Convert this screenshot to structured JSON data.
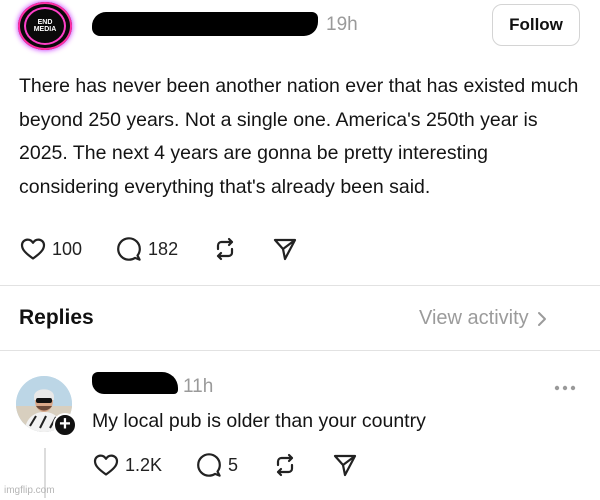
{
  "post": {
    "avatar": {
      "line1": "END",
      "line2": "MEDIA"
    },
    "time": "19h",
    "follow_label": "Follow",
    "text": "There has never been another nation ever that has existed much beyond 250 years. Not a single one. America's 250th year is 2025. The next 4 years are gonna be pretty interesting considering everything that's already been said.",
    "likes": "100",
    "comments": "182"
  },
  "replies_section": {
    "heading": "Replies",
    "view_activity": "View activity"
  },
  "reply": {
    "time": "11h",
    "text": "My local pub is older than your country",
    "likes": "1.2K",
    "comments": "5"
  },
  "watermark": "imgflip.com"
}
